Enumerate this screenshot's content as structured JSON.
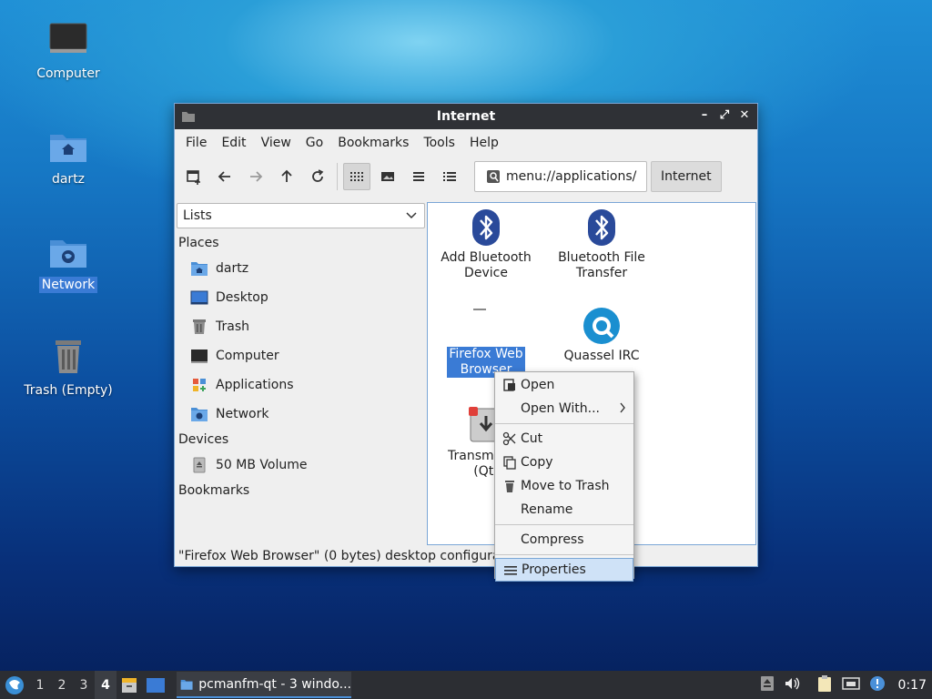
{
  "desktop": {
    "icons": [
      {
        "label": "Computer"
      },
      {
        "label": "dartz"
      },
      {
        "label": "Network"
      },
      {
        "label": "Trash (Empty)"
      }
    ]
  },
  "window": {
    "title": "Internet",
    "menu": [
      "File",
      "Edit",
      "View",
      "Go",
      "Bookmarks",
      "Tools",
      "Help"
    ],
    "address": "menu://applications/",
    "breadcrumb": "Internet",
    "side_mode": "Lists",
    "places_heading": "Places",
    "places": [
      "dartz",
      "Desktop",
      "Trash",
      "Computer",
      "Applications",
      "Network"
    ],
    "devices_heading": "Devices",
    "devices": [
      "50 MB Volume"
    ],
    "bookmarks_heading": "Bookmarks",
    "files": [
      {
        "name": "Add Bluetooth Device"
      },
      {
        "name": "Bluetooth File Transfer"
      },
      {
        "name": "Firefox Web Browser"
      },
      {
        "name": "Quassel IRC"
      },
      {
        "name": "Transmission (Qt)"
      }
    ],
    "status": "\"Firefox Web Browser\" (0 bytes) desktop configuration file"
  },
  "context_menu": {
    "items": [
      "Open",
      "Open With...",
      "Cut",
      "Copy",
      "Move to Trash",
      "Rename",
      "Compress",
      "Properties"
    ]
  },
  "taskbar": {
    "workspaces": [
      "1",
      "2",
      "3",
      "4"
    ],
    "task_label": "pcmanfm-qt - 3 windo...",
    "clock": "0:17"
  },
  "colors": {
    "accent": "#3a7bd5",
    "titlebar": "#2f3136",
    "bluetooth": "#2a4a9a",
    "quassel": "#1a8fd0"
  }
}
